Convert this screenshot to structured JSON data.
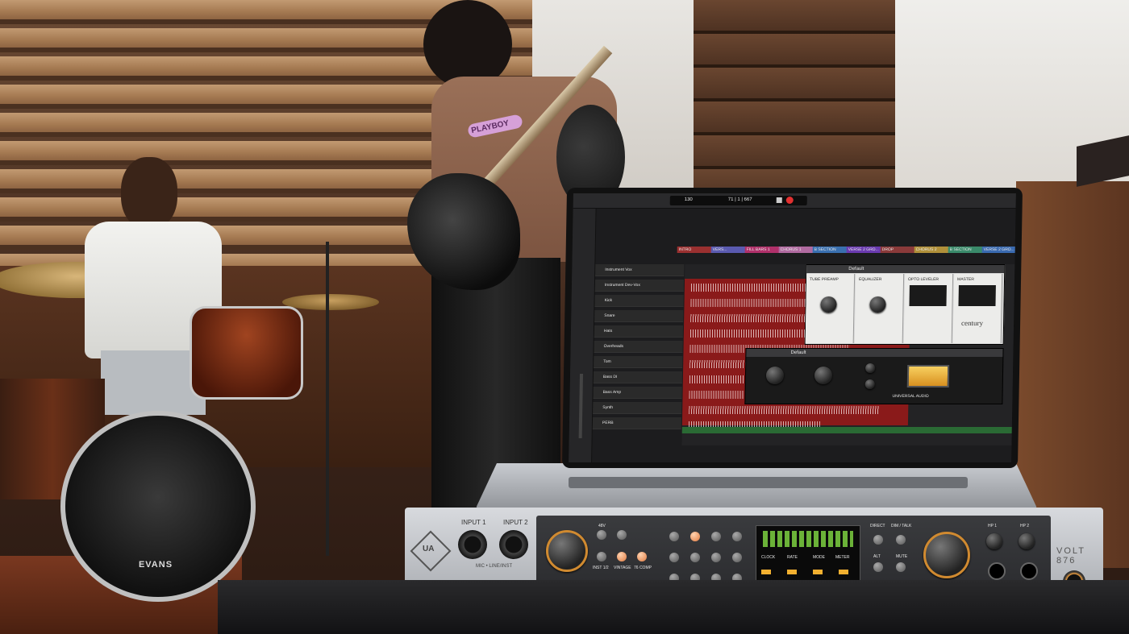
{
  "daw": {
    "sections": [
      "INTRO",
      "VERS...",
      "FILL BARS 1",
      "CHORUS 1",
      "B SECTION",
      "VERSE 2 GRO...",
      "DROP",
      "CHORUS 2",
      "B SECTION",
      "VERSE 2 GRO..."
    ],
    "tracks": [
      "Instrument Vox",
      "Instrument Dev-Vox",
      "Kick",
      "Snare",
      "Hats",
      "Overheads",
      "Tom",
      "Bass DI",
      "Bass Amp",
      "Synth",
      "PERB"
    ],
    "plugin_windows": {
      "top_title": "Default",
      "plugins": [
        "TUBE PREAMP",
        "EQUALIZER",
        "OPTO LEVELER",
        "MASTER"
      ],
      "master_brand": "century",
      "bottom_title": "Default",
      "bottom_brand": "UNIVERSAL AUDIO"
    },
    "transport_display": "71 | 1 | 667",
    "tempo": "130"
  },
  "interface": {
    "brand_logo": "UA",
    "inputs": [
      "INPUT 1",
      "INPUT 2"
    ],
    "input_caption": "MIC • LINE/INST",
    "preamp_labels": [
      "48V",
      "INST 1/2",
      "VINTAGE",
      "76 COMP"
    ],
    "meter_labels": [
      "CLOCK",
      "RATE",
      "MODE",
      "METER"
    ],
    "monitor_labels": [
      "DIRECT",
      "DIM / TALK",
      "ALT",
      "MUTE"
    ],
    "headphone_labels": [
      "HP 1",
      "HP 2"
    ],
    "model": "VOLT 876"
  },
  "drum": {
    "brand": "EVANS"
  },
  "shirt_text": "PLAYBOY",
  "colors": {
    "accent_orange": "#f0a040",
    "daw_red": "#8a1a1a",
    "led_green": "#7cd040",
    "led_amber": "#f2b030"
  }
}
